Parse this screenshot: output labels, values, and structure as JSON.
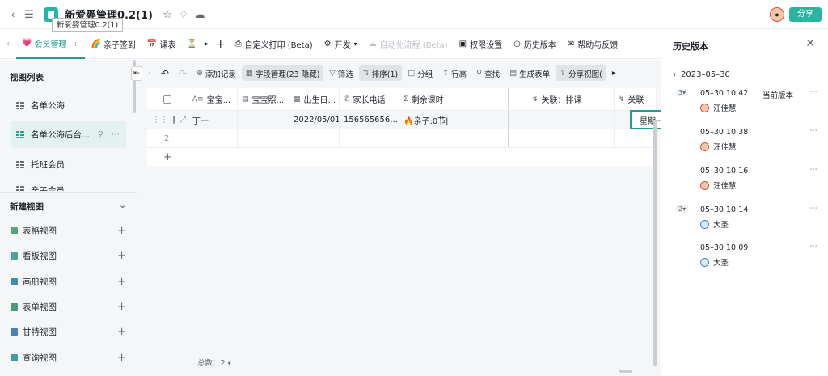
{
  "app": {
    "title": "新爱婴管理0.2(1)",
    "tooltip": "新爱婴管理0.2(1)",
    "share_label": "分享"
  },
  "tabs": [
    {
      "emoji": "💗",
      "label": "会员管理",
      "active": true
    },
    {
      "emoji": "🌈",
      "label": "亲子签到"
    },
    {
      "emoji": "📅",
      "label": "课表"
    },
    {
      "emoji": "⏳",
      "label": ""
    }
  ],
  "tab_actions": {
    "custom_print": "自定义打印 (Beta)",
    "develop": "开发",
    "automation": "自动化流程 (Beta)",
    "permissions": "权限设置",
    "history": "历史版本",
    "help": "帮助与反馈"
  },
  "sidebar": {
    "heading": "视图列表",
    "views": [
      {
        "label": "名单公海"
      },
      {
        "label": "名单公海后台..."
      },
      {
        "label": "托班会员"
      },
      {
        "label": "亲子会员"
      }
    ],
    "new_view_heading": "新建视图",
    "new_views": [
      {
        "label": "表格视图",
        "color": "#5aa47b"
      },
      {
        "label": "看板视图",
        "color": "#4aa3a0"
      },
      {
        "label": "画册视图",
        "color": "#3d8fb0"
      },
      {
        "label": "表单视图",
        "color": "#4a9a7c"
      },
      {
        "label": "甘特视图",
        "color": "#4b7fc0"
      },
      {
        "label": "查询视图",
        "color": "#3a9ea6"
      }
    ]
  },
  "toolbar": {
    "add_record": "添加记录",
    "field_manage": "字段管理(23 隐藏)",
    "filter": "筛选",
    "sort": "排序(1)",
    "group": "分组",
    "row_height": "行高",
    "find": "查找",
    "gen_form": "生成表单",
    "share_view": "分享视图("
  },
  "table": {
    "columns": [
      "宝宝...",
      "宝宝照...",
      "出生日...",
      "家长电话",
      "剩余课时",
      "关联：排课",
      "关联"
    ],
    "rows": [
      {
        "num": "",
        "name": "丁一",
        "photo": "",
        "birth": "2022/05/01",
        "phone": "156565656...",
        "remaining": "🔥亲子:0节|",
        "schedule": "",
        "link": "星期一"
      },
      {
        "num": "2",
        "name": "",
        "photo": "",
        "birth": "",
        "phone": "",
        "remaining": "",
        "schedule": "",
        "link": ""
      }
    ],
    "add_symbol": "+",
    "total": "总数：2"
  },
  "history": {
    "title": "历史版本",
    "date": "2023–05–30",
    "entries": [
      {
        "badge": "3",
        "time": "05–30 10:42",
        "current": "当前版本",
        "user": "汪佳慧",
        "avatar": "orange"
      },
      {
        "badge": "",
        "time": "05–30 10:38",
        "current": "",
        "user": "汪佳慧",
        "avatar": "orange"
      },
      {
        "badge": "",
        "time": "05–30 10:16",
        "current": "",
        "user": "汪佳慧",
        "avatar": "orange"
      },
      {
        "badge": "2",
        "time": "05–30 10:14",
        "current": "",
        "user": "大圣",
        "avatar": "blue"
      },
      {
        "badge": "",
        "time": "05–30 10:09",
        "current": "",
        "user": "大圣",
        "avatar": "blue"
      }
    ]
  },
  "colors": {
    "accent": "#1e9e8f",
    "share_button": "#2bb5a0"
  }
}
